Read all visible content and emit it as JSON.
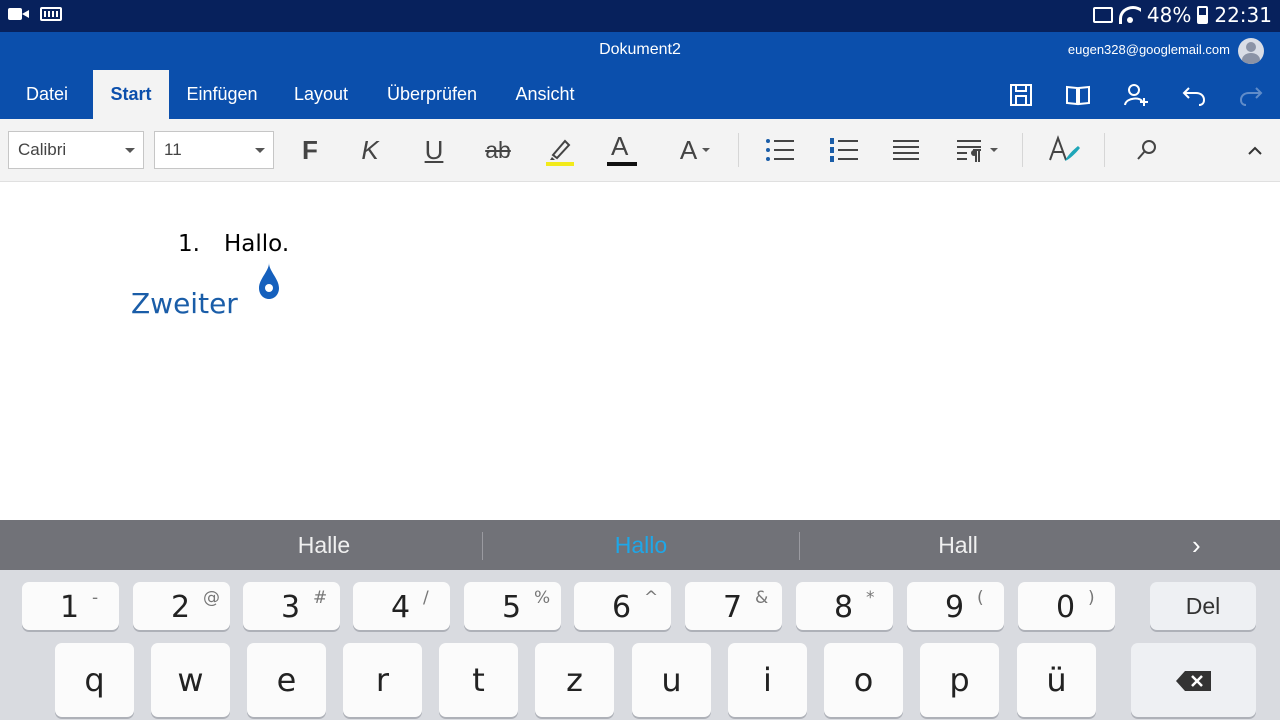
{
  "status_bar": {
    "battery": "48%",
    "time": "22:31"
  },
  "title_bar": {
    "document_title": "Dokument2",
    "account": "eugen328@googlemail.com"
  },
  "tabs": [
    {
      "label": "Datei"
    },
    {
      "label": "Start"
    },
    {
      "label": "Einfügen"
    },
    {
      "label": "Layout"
    },
    {
      "label": "Überprüfen"
    },
    {
      "label": "Ansicht"
    }
  ],
  "active_tab": "Start",
  "ribbon": {
    "font_name": "Calibri",
    "font_size": "11",
    "bold": "F",
    "italic": "K",
    "underline": "U",
    "strikethrough": "ab",
    "font_color_glyph": "A",
    "font_size_glyph": "A",
    "highlight_color": "#f2ea1a",
    "font_color": "#111111"
  },
  "document": {
    "list_number": "1.",
    "list_text": "Hallo.",
    "heading_text": "Zweiter",
    "heading_color": "#1a5da8"
  },
  "suggestions": [
    {
      "label": "Halle"
    },
    {
      "label": "Hallo"
    },
    {
      "label": "Hall"
    }
  ],
  "suggestion_arrow": "›",
  "keyboard": {
    "number_row": [
      {
        "main": "1",
        "sub": "-"
      },
      {
        "main": "2",
        "sub": "@"
      },
      {
        "main": "3",
        "sub": "#"
      },
      {
        "main": "4",
        "sub": "/"
      },
      {
        "main": "5",
        "sub": "%"
      },
      {
        "main": "6",
        "sub": "^"
      },
      {
        "main": "7",
        "sub": "&"
      },
      {
        "main": "8",
        "sub": "*"
      },
      {
        "main": "9",
        "sub": "("
      },
      {
        "main": "0",
        "sub": ")"
      }
    ],
    "del_label": "Del",
    "letter_row": [
      "q",
      "w",
      "e",
      "r",
      "t",
      "z",
      "u",
      "i",
      "o",
      "p",
      "ü"
    ]
  },
  "colors": {
    "app_blue": "#0b4fac",
    "status_bar": "#07215c",
    "suggestion_highlight": "#1ea7e8"
  }
}
